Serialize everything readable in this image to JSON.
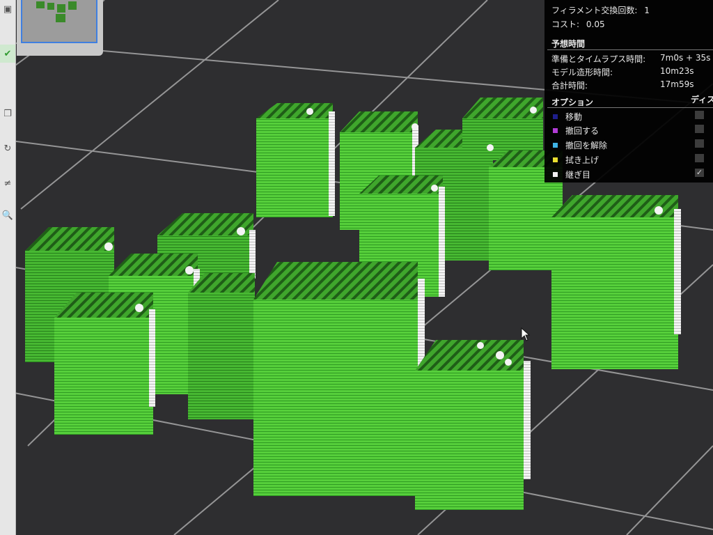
{
  "toolbar": {
    "tools": [
      {
        "name": "tool-arrange",
        "glyph": "▣"
      },
      {
        "name": "tool-layer",
        "glyph": "✔"
      },
      {
        "name": "tool-cut",
        "glyph": "❐"
      },
      {
        "name": "tool-rotate",
        "glyph": "↻"
      },
      {
        "name": "tool-support",
        "glyph": "≠"
      },
      {
        "name": "tool-search",
        "glyph": "🔍"
      }
    ]
  },
  "info_panel": {
    "filament_changes_label": "フィラメント交換回数:",
    "filament_changes_value": "1",
    "cost_label": "コスト:",
    "cost_value": "0.05",
    "time_section_title": "予想時間",
    "prep_timelapse_label": "準備とタイムラプス時間:",
    "prep_timelapse_value": "7m0s + 35s",
    "model_print_label": "モデル造形時間:",
    "model_print_value": "10m23s",
    "total_label": "合計時間:",
    "total_value": "17m59s",
    "options_title": "オプション",
    "display_column_label": "ディス",
    "options": [
      {
        "label": "移動",
        "color": "#1e1e8c",
        "checked": false
      },
      {
        "label": "撤回する",
        "color": "#b23cd6",
        "checked": false
      },
      {
        "label": "撤回を解除",
        "color": "#3fb3e6",
        "checked": false
      },
      {
        "label": "拭き上げ",
        "color": "#e8e030",
        "checked": false
      },
      {
        "label": "継ぎ目",
        "color": "#f2f2f2",
        "checked": true
      }
    ]
  },
  "colors": {
    "model": "#55cf3a",
    "model_shade": "#2d8d1e",
    "seam": "#f4f4f4",
    "plate": "#2e2e30",
    "grid_line": "#a8a8a8"
  },
  "icons": {
    "checkmark": "✓",
    "cursor": "pointer-arrow-icon"
  }
}
